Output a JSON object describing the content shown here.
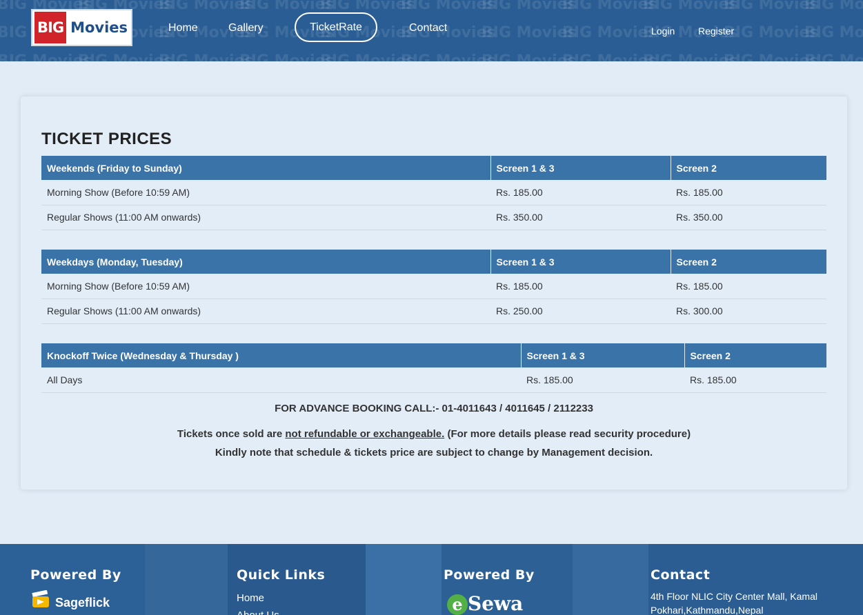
{
  "header": {
    "logo_big": "BIG",
    "logo_movies": "Movies",
    "pattern_text": "BIG Movies",
    "nav": [
      {
        "label": "Home"
      },
      {
        "label": "Gallery"
      },
      {
        "label": "TicketRate",
        "active": true
      },
      {
        "label": "Contact"
      }
    ],
    "auth": {
      "login": "Login",
      "register": "Register"
    }
  },
  "main": {
    "title": "TICKET PRICES",
    "tables": [
      {
        "headers": [
          "Weekends (Friday to Sunday)",
          "Screen 1 & 3",
          "Screen 2"
        ],
        "rows": [
          [
            "Morning Show (Before 10:59 AM)",
            "Rs. 185.00",
            "Rs. 185.00"
          ],
          [
            "Regular Shows (11:00 AM onwards)",
            "Rs. 350.00",
            "Rs. 350.00"
          ]
        ]
      },
      {
        "headers": [
          "Weekdays (Monday, Tuesday)",
          "Screen 1 & 3",
          "Screen 2"
        ],
        "rows": [
          [
            "Morning Show (Before 10:59 AM)",
            "Rs. 185.00",
            "Rs. 185.00"
          ],
          [
            "Regular Shows (11:00 AM onwards)",
            "Rs. 250.00",
            "Rs. 300.00"
          ]
        ]
      },
      {
        "headers": [
          "Knockoff Twice (Wednesday & Thursday )",
          "Screen 1 & 3",
          "Screen 2"
        ],
        "rows": [
          [
            "All Days",
            "Rs. 185.00",
            "Rs. 185.00"
          ]
        ]
      }
    ],
    "booking": "FOR ADVANCE BOOKING CALL:- 01-4011643 / 4011645 / 2112233",
    "notice1_pre": "Tickets once sold are ",
    "notice1_link": "not refundable or exchangeable.",
    "notice1_post": " (For more details please read security procedure)",
    "notice2": "Kindly note that schedule & tickets price are subject to change by Management decision."
  },
  "footer": {
    "powered_by_1": "Powered By",
    "sageflick": "Sageflick",
    "quick_links": "Quick Links",
    "links": [
      "Home",
      "About Us"
    ],
    "powered_by_2": "Powered By",
    "esewa": "Sewa",
    "contact": "Contact",
    "address": "4th Floor NLIC City Center Mall, Kamal Pokhari,Kathmandu,Nepal"
  },
  "colors": {
    "header_bg": "#2a5d94",
    "table_header": "#3a73a8",
    "page_bg": "#e1ecf7",
    "logo_red": "#d0232a"
  }
}
